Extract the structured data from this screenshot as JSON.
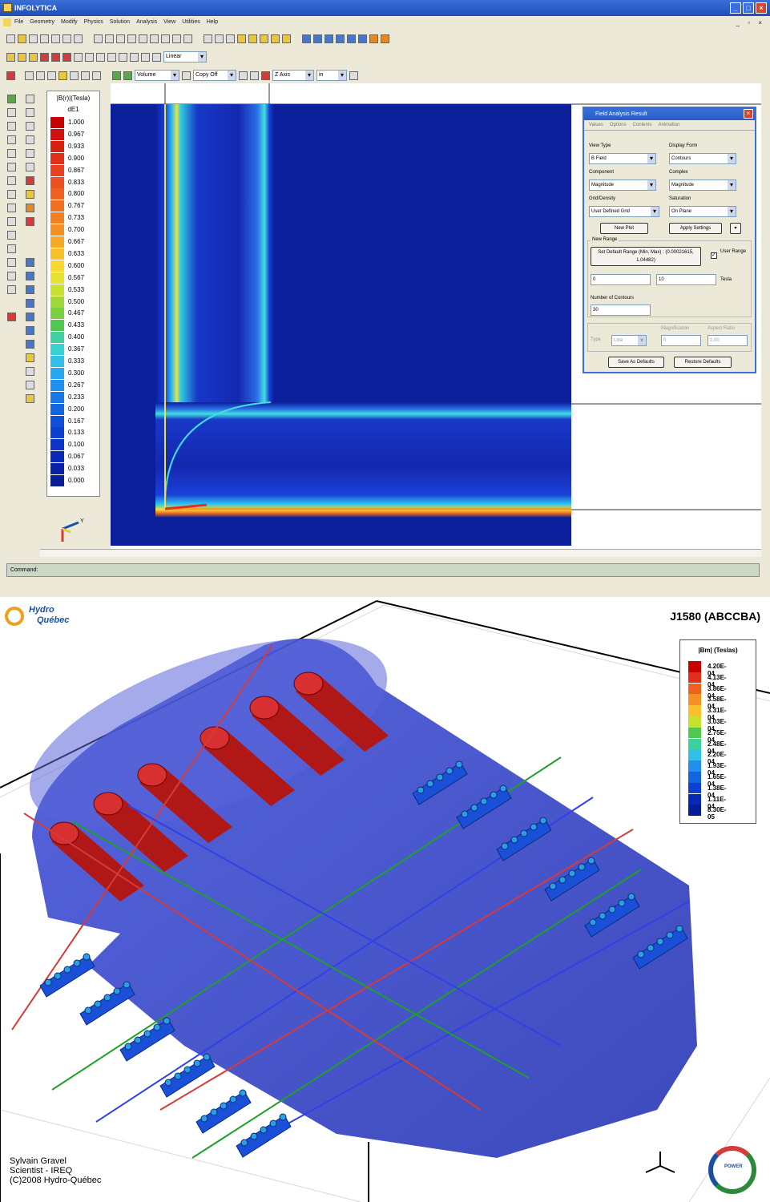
{
  "app": {
    "title": "INFOLYTICA",
    "menu": [
      "File",
      "Geometry",
      "Modify",
      "Physics",
      "Solution",
      "Analysis",
      "View",
      "Utilities",
      "Help"
    ],
    "combos": {
      "order": "Linear",
      "mode": "Volume",
      "copy": "Copy Off",
      "axis": "Z Axis",
      "unit": "in"
    },
    "legend": {
      "header1": "|B(r)|(Tesla)",
      "header2": "dE1",
      "values": [
        "1.000",
        "0.967",
        "0.933",
        "0.900",
        "0.867",
        "0.833",
        "0.800",
        "0.767",
        "0.733",
        "0.700",
        "0.667",
        "0.633",
        "0.600",
        "0.567",
        "0.533",
        "0.500",
        "0.467",
        "0.433",
        "0.400",
        "0.367",
        "0.333",
        "0.300",
        "0.267",
        "0.233",
        "0.200",
        "0.167",
        "0.133",
        "0.100",
        "0.067",
        "0.033",
        "0.000"
      ]
    },
    "command_label": "Command:"
  },
  "dialog": {
    "title": "Field Analysis Result",
    "menu": [
      "Values",
      "Options",
      "Contents",
      "Animation"
    ],
    "view_type_label": "View Type",
    "view_type": "B Field",
    "display_form_label": "Display Form",
    "display_form": "Contours",
    "component_label": "Component",
    "component": "Magnitude",
    "complex_label": "Complex",
    "complex": "Magnitude",
    "grid_label": "Grid/Density",
    "grid": "User Defined Grid",
    "saturation_label": "Saturation",
    "saturation": "On Plane",
    "new_plot": "New Plot",
    "apply_settings": "Apply Settings",
    "range_group": "New Range",
    "default_range": "Set Default Range (Min, Max) : (0.00021615, 1.04482)",
    "user_range": "User Range",
    "range_min": "0",
    "range_max": "10",
    "range_unit": "Tesla",
    "contours_label": "Number of Contours",
    "contours": "30",
    "magnification_label": "Magnification",
    "aspect_label": "Aspect Ratio",
    "magnification": "0",
    "aspect": "1.00",
    "type_label": "Type",
    "type": "Line",
    "save_defaults": "Save As Defaults",
    "restore_defaults": "Restore Defaults"
  },
  "render": {
    "title": "J1580 (ABCCBA)",
    "logo_line1": "Hydro",
    "logo_line2": "Québec",
    "legend_header": "|Bm| (Teslas)",
    "legend_values": [
      "4.20E-04",
      "4.13E-04",
      "3.86E-04",
      "3.58E-04",
      "3.31E-04",
      "3.03E-04",
      "2.75E-04",
      "2.48E-04",
      "2.20E-04",
      "1.93E-04",
      "1.65E-04",
      "1.38E-04",
      "1.11E-04",
      "8.30E-05"
    ],
    "credit1": "Sylvain Gravel",
    "credit2": "Scientist - IREQ",
    "credit3": "(C)2008 Hydro-Québec",
    "power_logo": "POWER"
  }
}
